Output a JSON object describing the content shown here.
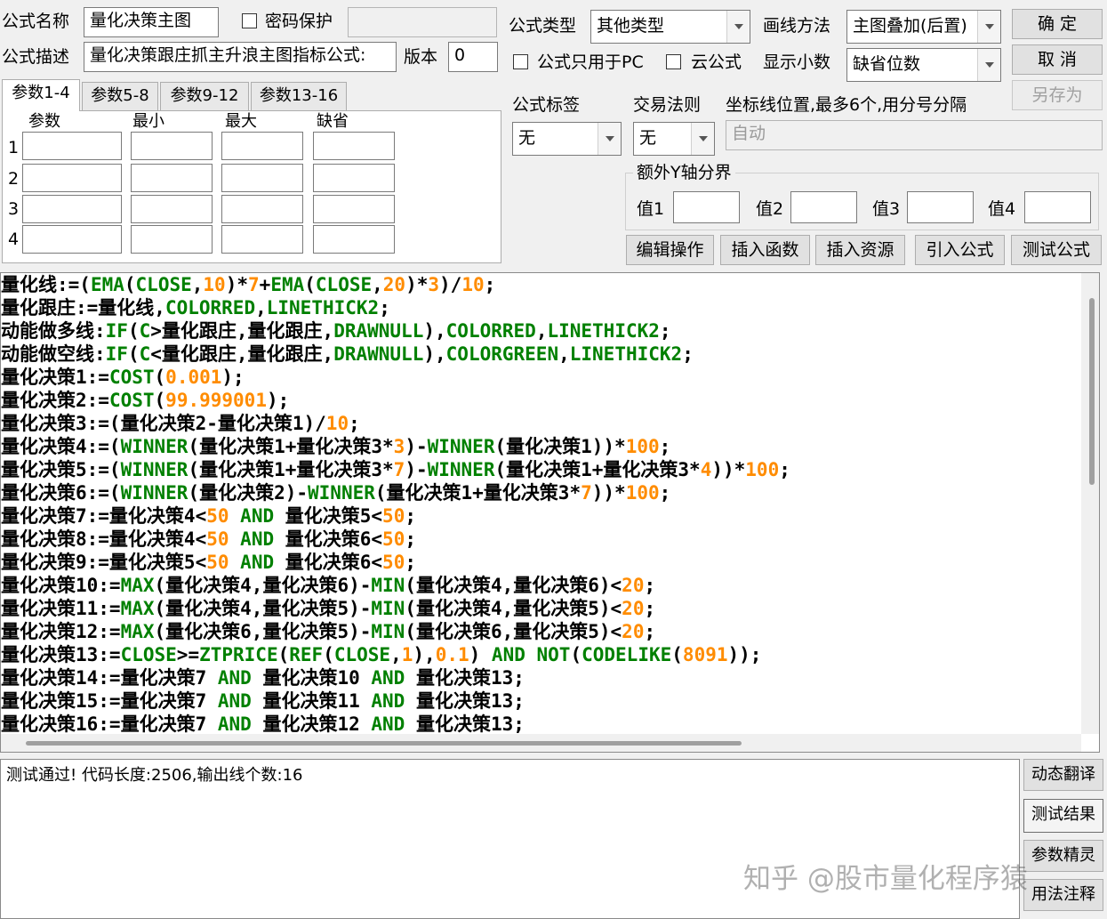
{
  "header": {
    "name_label": "公式名称",
    "name_value": "量化决策主图",
    "password_label": "密码保护",
    "desc_label": "公式描述",
    "desc_value": "量化决策跟庄抓主升浪主图指标公式:",
    "version_label": "版本",
    "version_value": "0",
    "type_label": "公式类型",
    "type_value": "其他类型",
    "draw_label": "画线方法",
    "draw_value": "主图叠加(后置)",
    "pc_only_label": "公式只用于PC",
    "cloud_label": "云公式",
    "decimals_label": "显示小数",
    "decimals_value": "缺省位数"
  },
  "buttons": {
    "ok": "确 定",
    "cancel": "取 消",
    "save_as": "另存为",
    "edit_ops": "编辑操作",
    "insert_func": "插入函数",
    "insert_res": "插入资源",
    "import_formula": "引入公式",
    "test_formula": "测试公式"
  },
  "params": {
    "tabs": [
      "参数1-4",
      "参数5-8",
      "参数9-12",
      "参数13-16"
    ],
    "columns": [
      "参数",
      "最小",
      "最大",
      "缺省"
    ],
    "rows": [
      "1",
      "2",
      "3",
      "4"
    ]
  },
  "tags": {
    "tag_label": "公式标签",
    "tag_value": "无",
    "trade_label": "交易法则",
    "trade_value": "无",
    "axis_label": "坐标线位置,最多6个,用分号分隔",
    "axis_value": "自动",
    "extra_y_label": "额外Y轴分界",
    "values": [
      "值1",
      "值2",
      "值3",
      "值4"
    ]
  },
  "code_lines": [
    [
      [
        "s",
        "量化线:=("
      ],
      [
        "k",
        "EMA"
      ],
      [
        "s",
        "("
      ],
      [
        "k",
        "CLOSE"
      ],
      [
        "s",
        ","
      ],
      [
        "n",
        "10"
      ],
      [
        "s",
        ")*"
      ],
      [
        "n",
        "7"
      ],
      [
        "s",
        "+"
      ],
      [
        "k",
        "EMA"
      ],
      [
        "s",
        "("
      ],
      [
        "k",
        "CLOSE"
      ],
      [
        "s",
        ","
      ],
      [
        "n",
        "20"
      ],
      [
        "s",
        ")*"
      ],
      [
        "n",
        "3"
      ],
      [
        "s",
        ")/"
      ],
      [
        "n",
        "10"
      ],
      [
        "s",
        ";"
      ]
    ],
    [
      [
        "s",
        "量化跟庄:=量化线,"
      ],
      [
        "k",
        "COLORRED"
      ],
      [
        "s",
        ","
      ],
      [
        "k",
        "LINETHICK2"
      ],
      [
        "s",
        ";"
      ]
    ],
    [
      [
        "s",
        "动能做多线:"
      ],
      [
        "k",
        "IF"
      ],
      [
        "s",
        "("
      ],
      [
        "k",
        "C"
      ],
      [
        "s",
        ">量化跟庄,量化跟庄,"
      ],
      [
        "k",
        "DRAWNULL"
      ],
      [
        "s",
        "),"
      ],
      [
        "k",
        "COLORRED"
      ],
      [
        "s",
        ","
      ],
      [
        "k",
        "LINETHICK2"
      ],
      [
        "s",
        ";"
      ]
    ],
    [
      [
        "s",
        "动能做空线:"
      ],
      [
        "k",
        "IF"
      ],
      [
        "s",
        "("
      ],
      [
        "k",
        "C"
      ],
      [
        "s",
        "<量化跟庄,量化跟庄,"
      ],
      [
        "k",
        "DRAWNULL"
      ],
      [
        "s",
        "),"
      ],
      [
        "k",
        "COLORGREEN"
      ],
      [
        "s",
        ","
      ],
      [
        "k",
        "LINETHICK2"
      ],
      [
        "s",
        ";"
      ]
    ],
    [
      [
        "s",
        "量化决策1:="
      ],
      [
        "k",
        "COST"
      ],
      [
        "s",
        "("
      ],
      [
        "n",
        "0.001"
      ],
      [
        "s",
        ");"
      ]
    ],
    [
      [
        "s",
        "量化决策2:="
      ],
      [
        "k",
        "COST"
      ],
      [
        "s",
        "("
      ],
      [
        "n",
        "99.999001"
      ],
      [
        "s",
        ");"
      ]
    ],
    [
      [
        "s",
        "量化决策3:=(量化决策2-量化决策1)/"
      ],
      [
        "n",
        "10"
      ],
      [
        "s",
        ";"
      ]
    ],
    [
      [
        "s",
        "量化决策4:=("
      ],
      [
        "k",
        "WINNER"
      ],
      [
        "s",
        "(量化决策1+量化决策3*"
      ],
      [
        "n",
        "3"
      ],
      [
        "s",
        ")-"
      ],
      [
        "k",
        "WINNER"
      ],
      [
        "s",
        "(量化决策1))*"
      ],
      [
        "n",
        "100"
      ],
      [
        "s",
        ";"
      ]
    ],
    [
      [
        "s",
        "量化决策5:=("
      ],
      [
        "k",
        "WINNER"
      ],
      [
        "s",
        "(量化决策1+量化决策3*"
      ],
      [
        "n",
        "7"
      ],
      [
        "s",
        ")-"
      ],
      [
        "k",
        "WINNER"
      ],
      [
        "s",
        "(量化决策1+量化决策3*"
      ],
      [
        "n",
        "4"
      ],
      [
        "s",
        "))*"
      ],
      [
        "n",
        "100"
      ],
      [
        "s",
        ";"
      ]
    ],
    [
      [
        "s",
        "量化决策6:=("
      ],
      [
        "k",
        "WINNER"
      ],
      [
        "s",
        "(量化决策2)-"
      ],
      [
        "k",
        "WINNER"
      ],
      [
        "s",
        "(量化决策1+量化决策3*"
      ],
      [
        "n",
        "7"
      ],
      [
        "s",
        "))*"
      ],
      [
        "n",
        "100"
      ],
      [
        "s",
        ";"
      ]
    ],
    [
      [
        "s",
        "量化决策7:=量化决策4<"
      ],
      [
        "n",
        "50"
      ],
      [
        "s",
        " "
      ],
      [
        "k",
        "AND"
      ],
      [
        "s",
        " 量化决策5<"
      ],
      [
        "n",
        "50"
      ],
      [
        "s",
        ";"
      ]
    ],
    [
      [
        "s",
        "量化决策8:=量化决策4<"
      ],
      [
        "n",
        "50"
      ],
      [
        "s",
        " "
      ],
      [
        "k",
        "AND"
      ],
      [
        "s",
        " 量化决策6<"
      ],
      [
        "n",
        "50"
      ],
      [
        "s",
        ";"
      ]
    ],
    [
      [
        "s",
        "量化决策9:=量化决策5<"
      ],
      [
        "n",
        "50"
      ],
      [
        "s",
        " "
      ],
      [
        "k",
        "AND"
      ],
      [
        "s",
        " 量化决策6<"
      ],
      [
        "n",
        "50"
      ],
      [
        "s",
        ";"
      ]
    ],
    [
      [
        "s",
        "量化决策10:="
      ],
      [
        "k",
        "MAX"
      ],
      [
        "s",
        "(量化决策4,量化决策6)-"
      ],
      [
        "k",
        "MIN"
      ],
      [
        "s",
        "(量化决策4,量化决策6)<"
      ],
      [
        "n",
        "20"
      ],
      [
        "s",
        ";"
      ]
    ],
    [
      [
        "s",
        "量化决策11:="
      ],
      [
        "k",
        "MAX"
      ],
      [
        "s",
        "(量化决策4,量化决策5)-"
      ],
      [
        "k",
        "MIN"
      ],
      [
        "s",
        "(量化决策4,量化决策5)<"
      ],
      [
        "n",
        "20"
      ],
      [
        "s",
        ";"
      ]
    ],
    [
      [
        "s",
        "量化决策12:="
      ],
      [
        "k",
        "MAX"
      ],
      [
        "s",
        "(量化决策6,量化决策5)-"
      ],
      [
        "k",
        "MIN"
      ],
      [
        "s",
        "(量化决策6,量化决策5)<"
      ],
      [
        "n",
        "20"
      ],
      [
        "s",
        ";"
      ]
    ],
    [
      [
        "s",
        "量化决策13:="
      ],
      [
        "k",
        "CLOSE"
      ],
      [
        "s",
        ">="
      ],
      [
        "k",
        "ZTPRICE"
      ],
      [
        "s",
        "("
      ],
      [
        "k",
        "REF"
      ],
      [
        "s",
        "("
      ],
      [
        "k",
        "CLOSE"
      ],
      [
        "s",
        ","
      ],
      [
        "n",
        "1"
      ],
      [
        "s",
        "),"
      ],
      [
        "n",
        "0.1"
      ],
      [
        "s",
        ") "
      ],
      [
        "k",
        "AND"
      ],
      [
        "s",
        " "
      ],
      [
        "k",
        "NOT"
      ],
      [
        "s",
        "("
      ],
      [
        "k",
        "CODELIKE"
      ],
      [
        "s",
        "("
      ],
      [
        "n",
        "8091"
      ],
      [
        "s",
        "));"
      ]
    ],
    [
      [
        "s",
        "量化决策14:=量化决策7 "
      ],
      [
        "k",
        "AND"
      ],
      [
        "s",
        " 量化决策10 "
      ],
      [
        "k",
        "AND"
      ],
      [
        "s",
        " 量化决策13;"
      ]
    ],
    [
      [
        "s",
        "量化决策15:=量化决策7 "
      ],
      [
        "k",
        "AND"
      ],
      [
        "s",
        " 量化决策11 "
      ],
      [
        "k",
        "AND"
      ],
      [
        "s",
        " 量化决策13;"
      ]
    ],
    [
      [
        "s",
        "量化决策16:=量化决策7 "
      ],
      [
        "k",
        "AND"
      ],
      [
        "s",
        " 量化决策12 "
      ],
      [
        "k",
        "AND"
      ],
      [
        "s",
        " 量化决策13;"
      ]
    ]
  ],
  "output": {
    "message": "测试通过! 代码长度:2506,输出线个数:16"
  },
  "side_buttons": [
    "动态翻译",
    "测试结果",
    "参数精灵",
    "用法注释"
  ],
  "watermark": "知乎 @股市量化程序猿"
}
